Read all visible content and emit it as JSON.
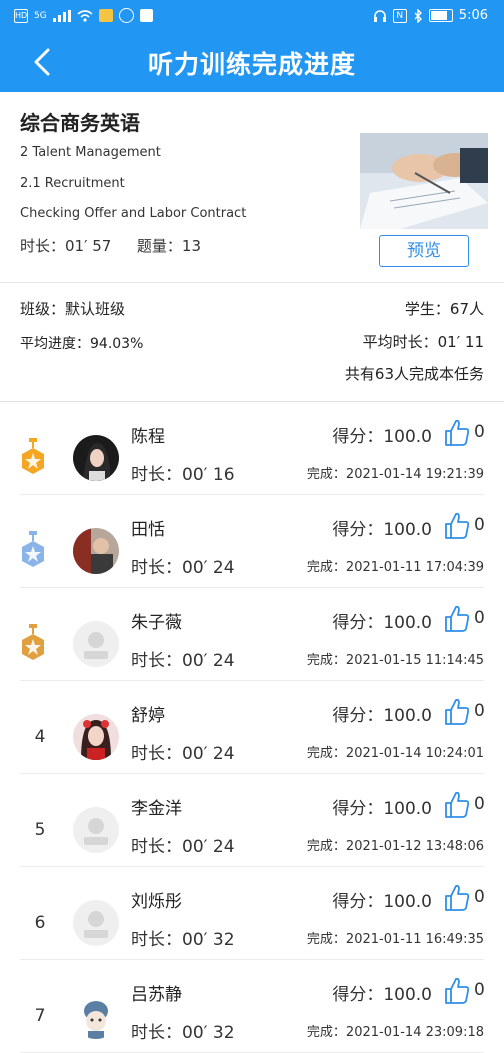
{
  "status": {
    "network": "HD",
    "signal": "5G",
    "time": "5:06"
  },
  "header": {
    "title": "听力训练完成进度"
  },
  "course": {
    "name": "综合商务英语",
    "unit": "2 Talent Management",
    "section": "2.1 Recruitment",
    "lesson": "Checking Offer and Labor Contract",
    "duration": "时长：01′ 57",
    "questions": "题量：13",
    "preview_label": "预览"
  },
  "summary": {
    "class_label": "班级：默认班级",
    "students": "学生：67人",
    "avg_progress": "平均进度：94.03%",
    "avg_duration": "平均时长：01′ 11",
    "completed": "共有63人完成本任务"
  },
  "rows": [
    {
      "rank": "",
      "medal": "gold",
      "name": "陈程",
      "score": "得分：100.0",
      "likes": "0",
      "duration": "时长：00′ 16",
      "done": "完成：2021-01-14 19:21:39",
      "avatar": "photo-girl"
    },
    {
      "rank": "",
      "medal": "silver",
      "name": "田恬",
      "score": "得分：100.0",
      "likes": "0",
      "duration": "时长：00′ 24",
      "done": "完成：2021-01-11 17:04:39",
      "avatar": "photo-autumn"
    },
    {
      "rank": "",
      "medal": "bronze",
      "name": "朱子薇",
      "score": "得分：100.0",
      "likes": "0",
      "duration": "时长：00′ 24",
      "done": "完成：2021-01-15 11:14:45",
      "avatar": "default"
    },
    {
      "rank": "4",
      "medal": "",
      "name": "舒婷",
      "score": "得分：100.0",
      "likes": "0",
      "duration": "时长：00′ 24",
      "done": "完成：2021-01-14 10:24:01",
      "avatar": "photo-red"
    },
    {
      "rank": "5",
      "medal": "",
      "name": "李金洋",
      "score": "得分：100.0",
      "likes": "0",
      "duration": "时长：00′ 24",
      "done": "完成：2021-01-12 13:48:06",
      "avatar": "default"
    },
    {
      "rank": "6",
      "medal": "",
      "name": "刘烁彤",
      "score": "得分：100.0",
      "likes": "0",
      "duration": "时长：00′ 32",
      "done": "完成：2021-01-11 16:49:35",
      "avatar": "default"
    },
    {
      "rank": "7",
      "medal": "",
      "name": "吕苏静",
      "score": "得分：100.0",
      "likes": "0",
      "duration": "时长：00′ 32",
      "done": "完成：2021-01-14 23:09:18",
      "avatar": "cartoon"
    }
  ],
  "colors": {
    "primary": "#2196f3",
    "accent": "#2f8fe8",
    "gold": "#f5a623",
    "silver": "#8ab4e8",
    "bronze": "#e0a040"
  }
}
